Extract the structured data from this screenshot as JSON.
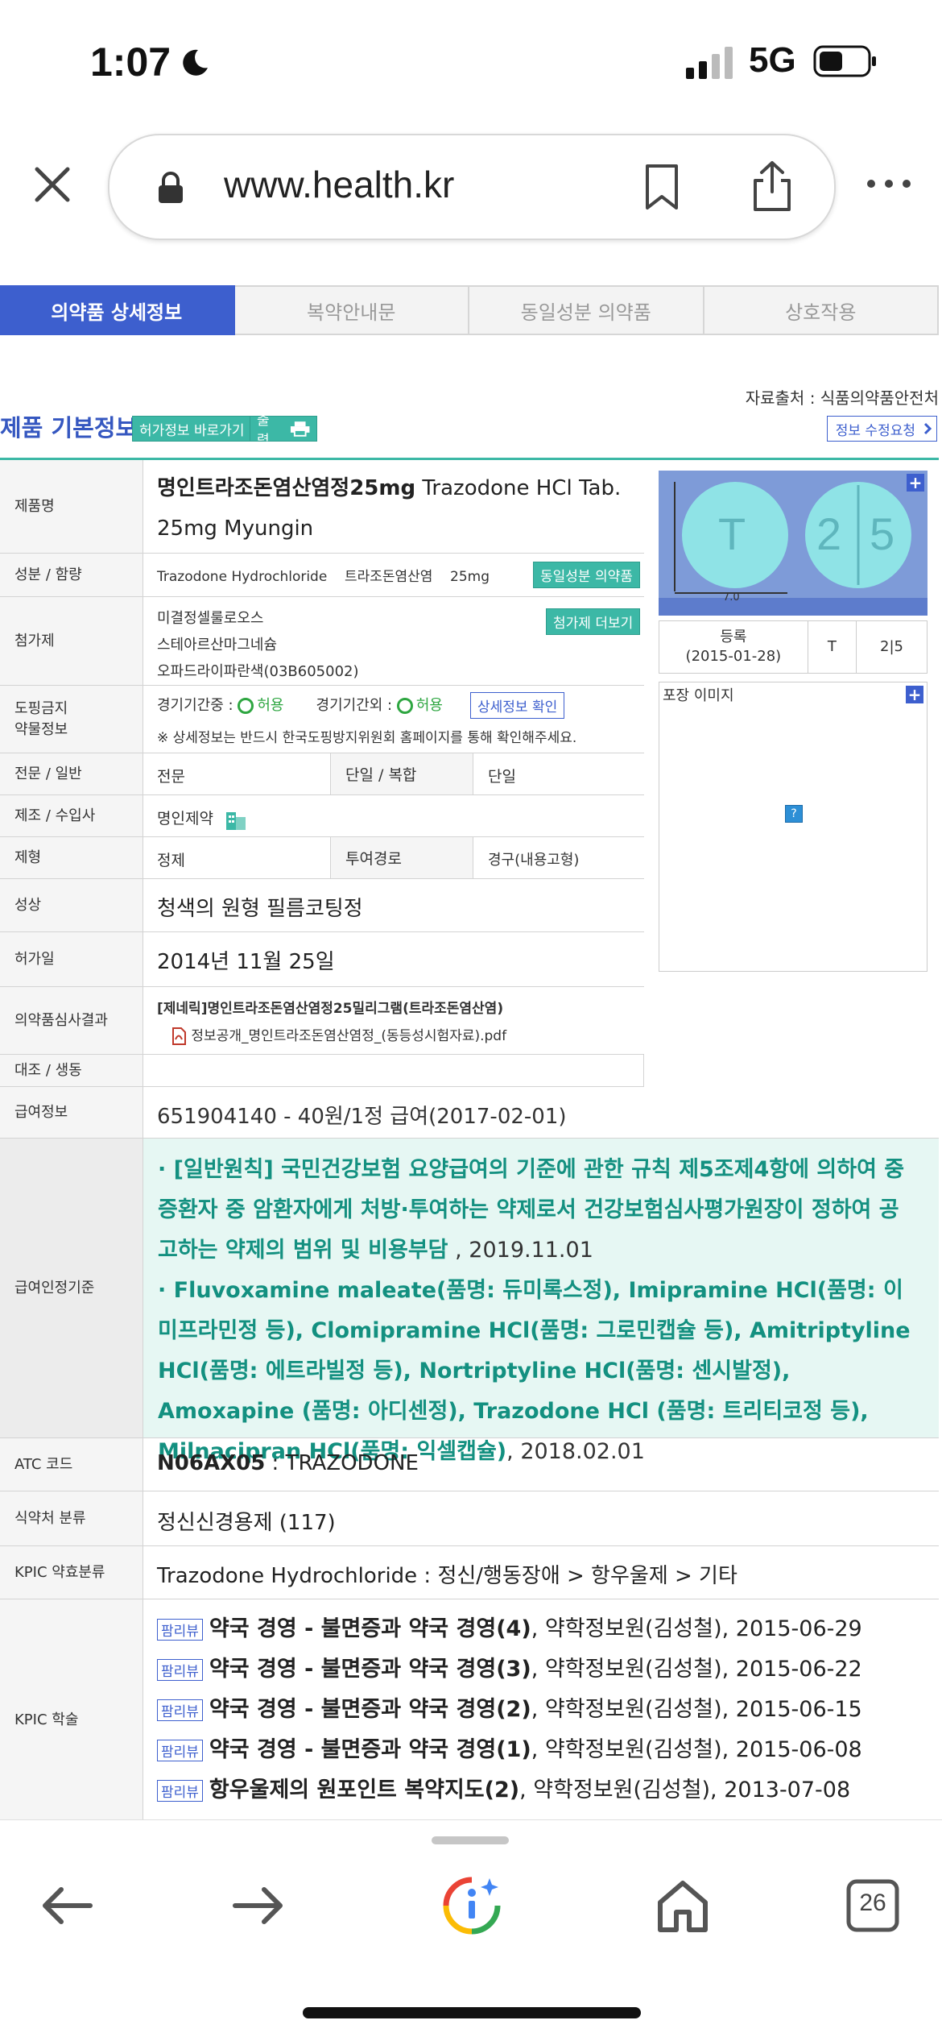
{
  "status_bar": {
    "time": "1:07",
    "network": "5G"
  },
  "browser": {
    "url": "www.health.kr",
    "tab_count": "26"
  },
  "tabs": [
    {
      "label": "의약품 상세정보",
      "active": true
    },
    {
      "label": "복약안내문",
      "active": false
    },
    {
      "label": "동일성분 의약품",
      "active": false
    },
    {
      "label": "상호작용",
      "active": false
    }
  ],
  "header": {
    "source": "자료출처 : 식품의약품안전처",
    "title": "제품 기본정보",
    "permit_btn": "허가정보 바로가기",
    "print_btn": "출력",
    "edit_btn": "정보 수정요청"
  },
  "product": {
    "name_label": "제품명",
    "name_ko": "명인트라조돈염산염정25mg",
    "name_en_1": "Trazodone HCl Tab.",
    "name_en_2": "25mg Myungin",
    "ingredient_label": "성분 / 함량",
    "ingredient_en": "Trazodone Hydrochloride",
    "ingredient_ko": "트라조돈염산염",
    "ingredient_amount": "25mg",
    "same_ingredient_btn": "동일성분 의약품",
    "additive_label": "첨가제",
    "additives": [
      "미결정셀룰로오스",
      "스테아르산마그네슘",
      "오파드라이파란색(03B605002)"
    ],
    "additive_more_btn": "첨가제 더보기",
    "doping_label_1": "도핑금지",
    "doping_label_2": "약물정보",
    "doping_in_label": "경기기간중 :",
    "doping_in_value": "허용",
    "doping_out_label": "경기기간외 :",
    "doping_out_value": "허용",
    "doping_detail_btn": "상세정보 확인",
    "doping_note": "※ 상세정보는 반드시 한국도핑방지위원회 홈페이지를 통해 확인해주세요.",
    "category_label": "전문 / 일반",
    "category_value": "전문",
    "single_label": "단일 / 복합",
    "single_value": "단일",
    "maker_label": "제조 / 수입사",
    "maker_value": "명인제약",
    "form_label": "제형",
    "form_value": "정제",
    "route_label": "투여경로",
    "route_value": "경구(내용고형)",
    "shape_label": "성상",
    "shape_value": "청색의 원형 필름코팅정",
    "permit_date_label": "허가일",
    "permit_date_value": "2014년 11월 25일",
    "review_label": "의약품심사결과",
    "review_title": "[제네릭]명인트라조돈염산염정25밀리그램(트라조돈염산염)",
    "review_file": "정보공개_명인트라조돈염산염정_(동등성시험자료).pdf",
    "control_label": "대조 / 생동",
    "insurance_label": "급여정보",
    "insurance_value": "651904140 - 40원/1정 급여(2017-02-01)",
    "criteria_label": "급여인정기준",
    "criteria_1_bold": "· [일반원칙] 국민건강보험 요양급여의 기준에 관한 규칙 제5조제4항에 의하여 중증환자 중 암환자에게 처방·투여하는 약제로서 건강보험심사평가원장이 정하여 공고하는 약제의 범위 및 비용부담",
    "criteria_1_date": " , 2019.11.01",
    "criteria_2_bold": "· Fluvoxamine maleate(품명: 듀미록스정), Imipramine HCl(품명: 이미프라민정 등), Clomipramine HCl(품명: 그로민캡슐 등), Amitriptyline HCl(품명: 에트라빌정 등), Nortriptyline HCl(품명: 센시발정), Amoxapine (품명: 아디센정), Trazodone HCl (품명: 트리티코정 등), Milnacipran HCl(품명: 익셀캡슐)",
    "criteria_2_date": ", 2018.02.01",
    "atc_label": "ATC 코드",
    "atc_code": "N06AX05",
    "atc_name": " : TRAZODONE",
    "mfds_label": "식약처 분류",
    "mfds_value": "정신신경용제 (117)",
    "kpic_class_label": "KPIC 약효분류",
    "kpic_class_value": "Trazodone Hydrochloride : 정신/행동장애 > 항우울제 > 기타",
    "kpic_academic_label": "KPIC 학술",
    "kpic_badge": "팜리뷰",
    "kpic_items": [
      {
        "title": "약국 경영 - 불면증과 약국 경영(4)",
        "meta": ", 약학정보원(김성철), 2015-06-29"
      },
      {
        "title": "약국 경영 - 불면증과 약국 경영(3)",
        "meta": ", 약학정보원(김성철), 2015-06-22"
      },
      {
        "title": "약국 경영 - 불면증과 약국 경영(2)",
        "meta": ", 약학정보원(김성철), 2015-06-15"
      },
      {
        "title": "약국 경영 - 불면증과 약국 경영(1)",
        "meta": ", 약학정보원(김성철), 2015-06-08"
      },
      {
        "title": "항우울제의 원포인트 복약지도(2)",
        "meta": ", 약학정보원(김성철), 2013-07-08"
      }
    ]
  },
  "image_panel": {
    "pill_front": "T",
    "pill_back_left": "2",
    "pill_back_right": "5",
    "scale_label": "7.0",
    "reg_label": "등록",
    "reg_date": "(2015-01-28)",
    "mark_front": "T",
    "mark_back": "2|5",
    "package_label": "포장 이미지",
    "missing_icon": "?"
  },
  "colors": {
    "accent_blue": "#3d5fce",
    "mint": "#3cb8a6",
    "green_text": "#139080"
  }
}
